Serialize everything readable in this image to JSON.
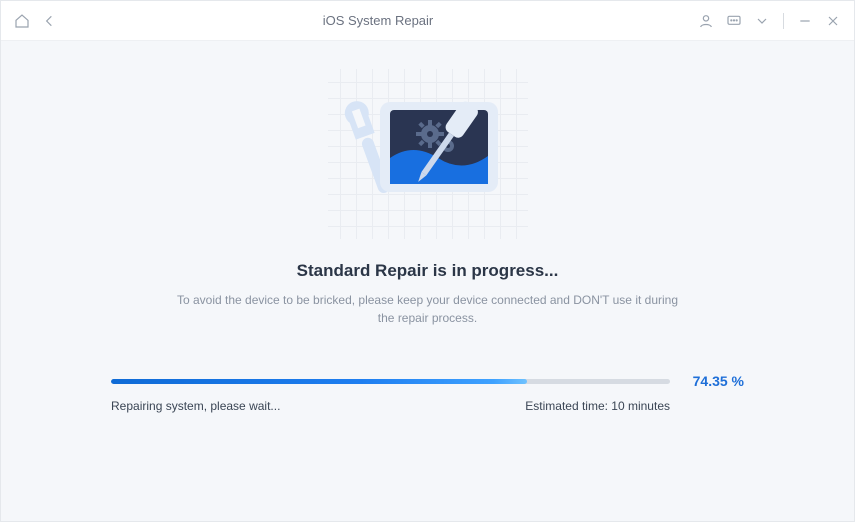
{
  "titlebar": {
    "title": "iOS System Repair"
  },
  "main": {
    "heading": "Standard Repair is in progress...",
    "subtext": "To avoid the device to be bricked, please keep your device connected and DON'T use it during the repair process."
  },
  "progress": {
    "percent_value": 74.35,
    "percent_label": "74.35 %",
    "status_text": "Repairing system, please wait...",
    "eta_text": "Estimated time: 10 minutes"
  },
  "colors": {
    "accent": "#1e6fd8"
  }
}
